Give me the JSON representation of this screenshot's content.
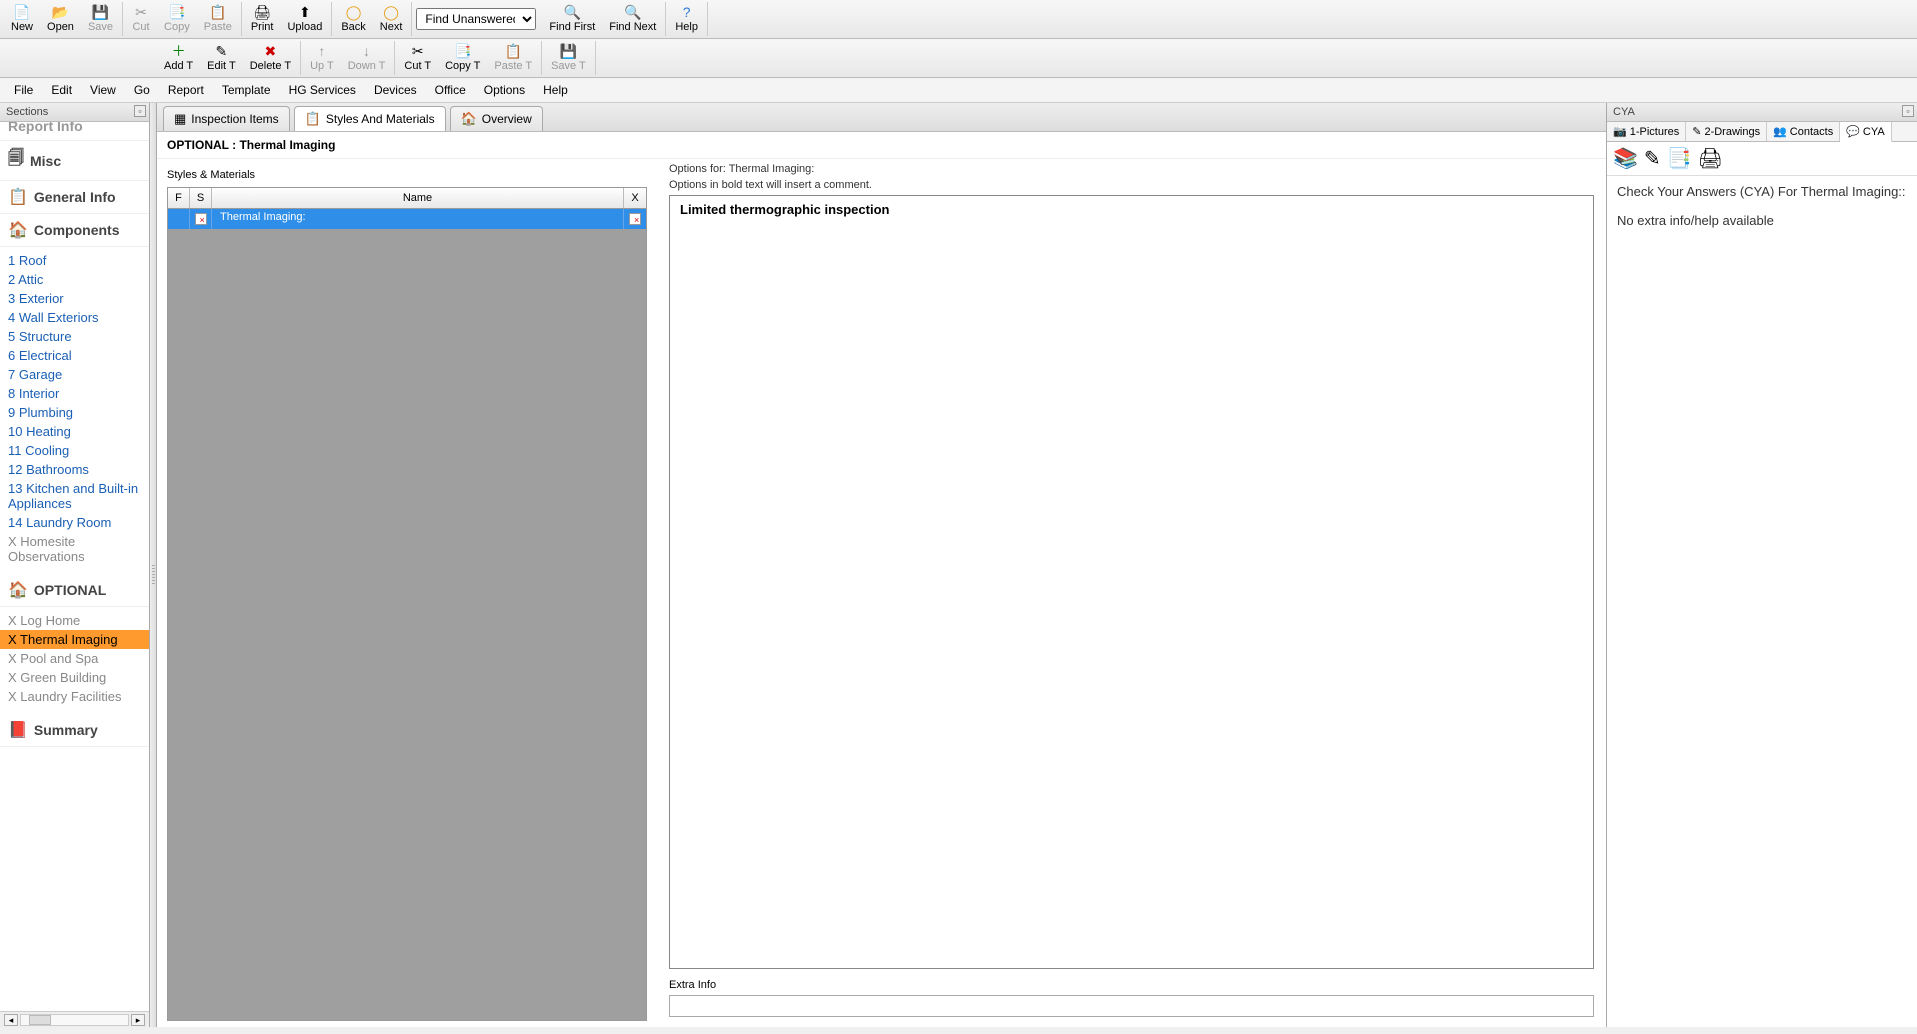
{
  "toolbar1": {
    "new": "New",
    "open": "Open",
    "save": "Save",
    "cut": "Cut",
    "copy": "Copy",
    "paste": "Paste",
    "print": "Print",
    "upload": "Upload",
    "back": "Back",
    "next": "Next",
    "find_select": "Find Unanswered",
    "find_first": "Find First",
    "find_next": "Find Next",
    "help": "Help"
  },
  "toolbar2": {
    "add_t": "Add T",
    "edit_t": "Edit T",
    "delete_t": "Delete T",
    "up_t": "Up T",
    "down_t": "Down T",
    "cut_t": "Cut T",
    "copy_t": "Copy T",
    "paste_t": "Paste T",
    "save_t": "Save T"
  },
  "menubar": [
    "File",
    "Edit",
    "View",
    "Go",
    "Report",
    "Template",
    "HG Services",
    "Devices",
    "Office",
    "Options",
    "Help"
  ],
  "left": {
    "title": "Sections",
    "report_info": "Report Info",
    "misc": "Misc",
    "general_info": "General Info",
    "components": "Components",
    "component_items": [
      "1 Roof",
      "2 Attic",
      "3 Exterior",
      "4 Wall Exteriors",
      "5 Structure",
      "6 Electrical",
      "7 Garage",
      "8 Interior",
      "9 Plumbing",
      "10 Heating",
      "11 Cooling",
      "12 Bathrooms",
      "13 Kitchen and Built-in Appliances",
      "14 Laundry Room"
    ],
    "component_muted": "X Homesite Observations",
    "optional": "OPTIONAL",
    "optional_items": [
      {
        "label": "X Log Home",
        "muted": true,
        "active": false
      },
      {
        "label": "X Thermal Imaging",
        "muted": false,
        "active": true
      },
      {
        "label": "X Pool and Spa",
        "muted": true,
        "active": false
      },
      {
        "label": "X Green Building",
        "muted": true,
        "active": false
      },
      {
        "label": "X Laundry Facilities",
        "muted": true,
        "active": false
      }
    ],
    "summary": "Summary"
  },
  "tabs": {
    "inspection": "Inspection Items",
    "styles": "Styles And Materials",
    "overview": "Overview"
  },
  "content": {
    "heading": "OPTIONAL : Thermal Imaging",
    "styles_materials": "Styles & Materials",
    "grid_cols": {
      "f": "F",
      "s": "S",
      "name": "Name",
      "x": "X"
    },
    "grid_row_name": "Thermal Imaging:",
    "opts_for": "Options for: Thermal Imaging:",
    "opts_hint": "Options in bold text will insert a comment.",
    "option1": "Limited thermographic inspection",
    "extra_info": "Extra Info",
    "extra_value": ""
  },
  "right": {
    "title": "CYA",
    "tabs": {
      "pictures": "1-Pictures",
      "drawings": "2-Drawings",
      "contacts": "Contacts",
      "cya": "CYA"
    },
    "body_title": "Check Your Answers (CYA) For Thermal Imaging::",
    "body_text": "No extra info/help available"
  }
}
